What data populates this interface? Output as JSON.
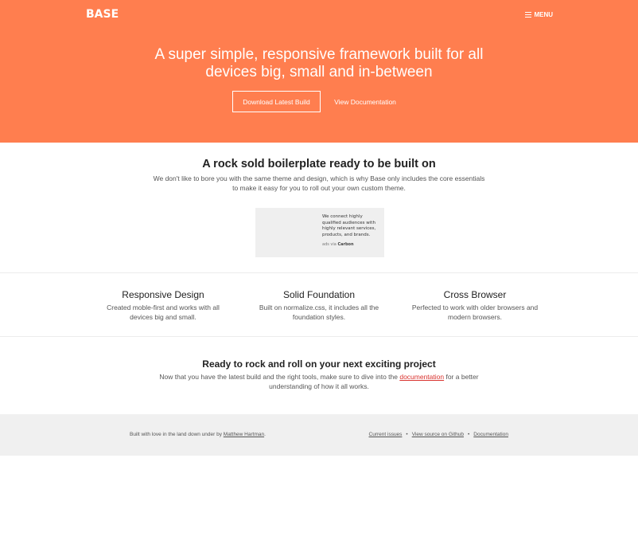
{
  "header": {
    "logo": "BASE",
    "menu_label": "MENU",
    "menu_icon": "hamburger-icon",
    "background_color": "#ff7e4f"
  },
  "hero": {
    "title_line1": "A super simple, responsive framework built for all",
    "title_line2": "devices big, small and in-between",
    "download_button": "Download Latest Build",
    "docs_button": "View Documentation"
  },
  "intro": {
    "title": "A rock sold boilerplate ready to be built on",
    "text_line1": "We don't like to bore you with the same theme and design, which is why Base only includes the core essentials",
    "text_line2": "to make it easy for you to roll out your own custom theme."
  },
  "ad": {
    "text": "We connect highly qualified audiences with highly relevant services, products, and brands.",
    "via": "ads via",
    "brand": "Carbon"
  },
  "features": [
    {
      "title": "Responsive Design",
      "desc_line1": "Created moble-first and works with all",
      "desc_line2": "devices big and small."
    },
    {
      "title": "Solid Foundation",
      "desc_line1": "Built on normalize.css, it includes all the",
      "desc_line2": "foundation styles."
    },
    {
      "title": "Cross Browser",
      "desc_line1": "Perfected to work with older browsers and",
      "desc_line2": "modern browsers."
    }
  ],
  "cta": {
    "title": "Ready to rock and roll on your next exciting project",
    "text_before": "Now that you have the latest build and the right tools, make sure to dive into the ",
    "link": "documentation",
    "text_after": " for a better",
    "text_line2": "understanding of how it all works.",
    "link_color": "#d9322e"
  },
  "footer": {
    "credit_prefix": "Built with love in the land down under by ",
    "credit_author": "Matthew Hartman",
    "credit_suffix": ".",
    "links": [
      "Current issues",
      "View source on Github",
      "Documentation"
    ],
    "separator": "•"
  }
}
